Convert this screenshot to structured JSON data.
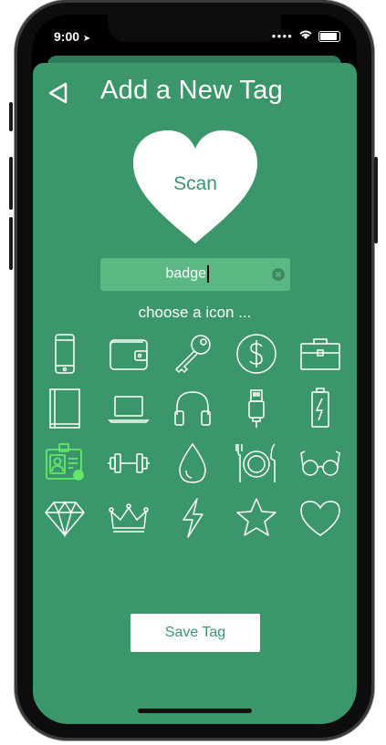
{
  "status": {
    "time": "9:00"
  },
  "header": {
    "title": "Add a New Tag"
  },
  "scan": {
    "label": "Scan"
  },
  "search": {
    "value": "badge"
  },
  "picker": {
    "subtitle": "choose a icon ..."
  },
  "icons": [
    {
      "name": "smartphone-icon",
      "selected": false
    },
    {
      "name": "wallet-icon",
      "selected": false
    },
    {
      "name": "key-icon",
      "selected": false
    },
    {
      "name": "dollar-coin-icon",
      "selected": false
    },
    {
      "name": "briefcase-icon",
      "selected": false
    },
    {
      "name": "book-icon",
      "selected": false
    },
    {
      "name": "laptop-icon",
      "selected": false
    },
    {
      "name": "headphones-icon",
      "selected": false
    },
    {
      "name": "usb-icon",
      "selected": false
    },
    {
      "name": "battery-charging-icon",
      "selected": false
    },
    {
      "name": "id-badge-icon",
      "selected": true
    },
    {
      "name": "dumbbell-icon",
      "selected": false
    },
    {
      "name": "water-drop-icon",
      "selected": false
    },
    {
      "name": "dining-plate-icon",
      "selected": false
    },
    {
      "name": "glasses-icon",
      "selected": false
    },
    {
      "name": "diamond-icon",
      "selected": false
    },
    {
      "name": "crown-icon",
      "selected": false
    },
    {
      "name": "lightning-icon",
      "selected": false
    },
    {
      "name": "star-icon",
      "selected": false
    },
    {
      "name": "heart-icon",
      "selected": false
    }
  ],
  "footer": {
    "save_label": "Save Tag"
  },
  "colors": {
    "background": "#3c966b",
    "selected_icon": "#62e86b",
    "search_bg": "#5cb882"
  }
}
